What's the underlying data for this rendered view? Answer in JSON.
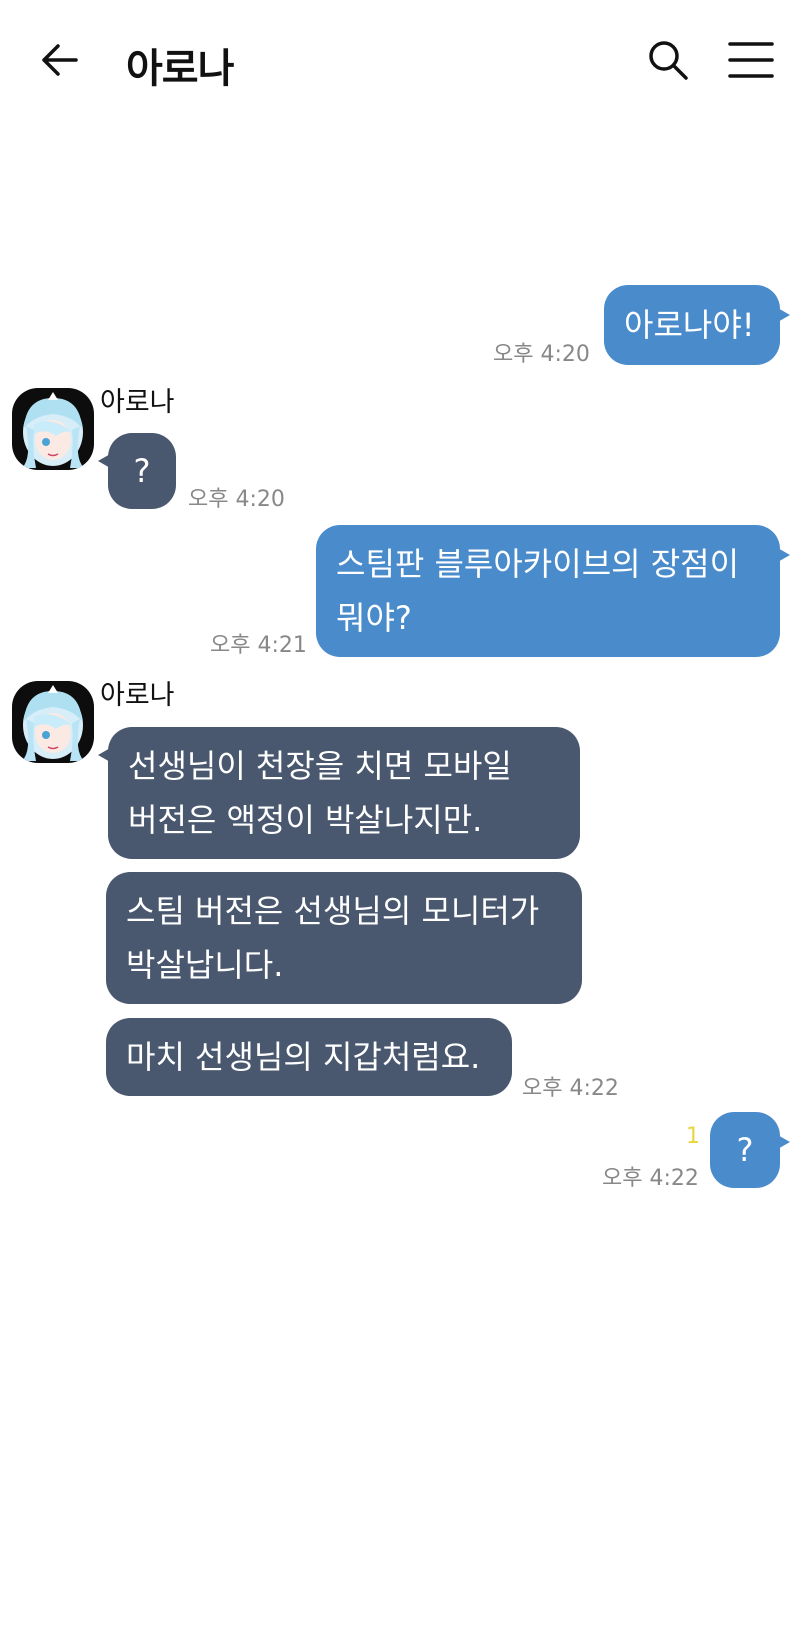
{
  "header": {
    "title": "아로나",
    "back_icon": "arrow-left-icon",
    "search_icon": "search-icon",
    "menu_icon": "hamburger-menu-icon"
  },
  "colors": {
    "outgoing_bubble": "#4a8bcc",
    "incoming_bubble": "#4a586f",
    "timestamp": "#888888",
    "unread": "#e8d63a"
  },
  "messages": [
    {
      "from": "me",
      "text": "아로나야!",
      "time": "오후 4:20"
    },
    {
      "from": "아로나",
      "sender_name": "아로나",
      "text": "?",
      "time": "오후 4:20"
    },
    {
      "from": "me",
      "lines": [
        "스팀판 블루아카이브의 장점이",
        "뭐야?"
      ],
      "time": "오후 4:21"
    },
    {
      "from": "아로나",
      "sender_name": "아로나",
      "lines": [
        "선생님이 천장을 치면 모바일",
        "버전은 액정이 박살나지만."
      ]
    },
    {
      "from": "아로나",
      "lines": [
        "스팀 버전은 선생님의 모니터가",
        "박살납니다."
      ]
    },
    {
      "from": "아로나",
      "text": "마치 선생님의 지갑처럼요.",
      "time": "오후 4:22"
    },
    {
      "from": "me",
      "text": "?",
      "time": "오후 4:22",
      "unread": "1"
    }
  ]
}
